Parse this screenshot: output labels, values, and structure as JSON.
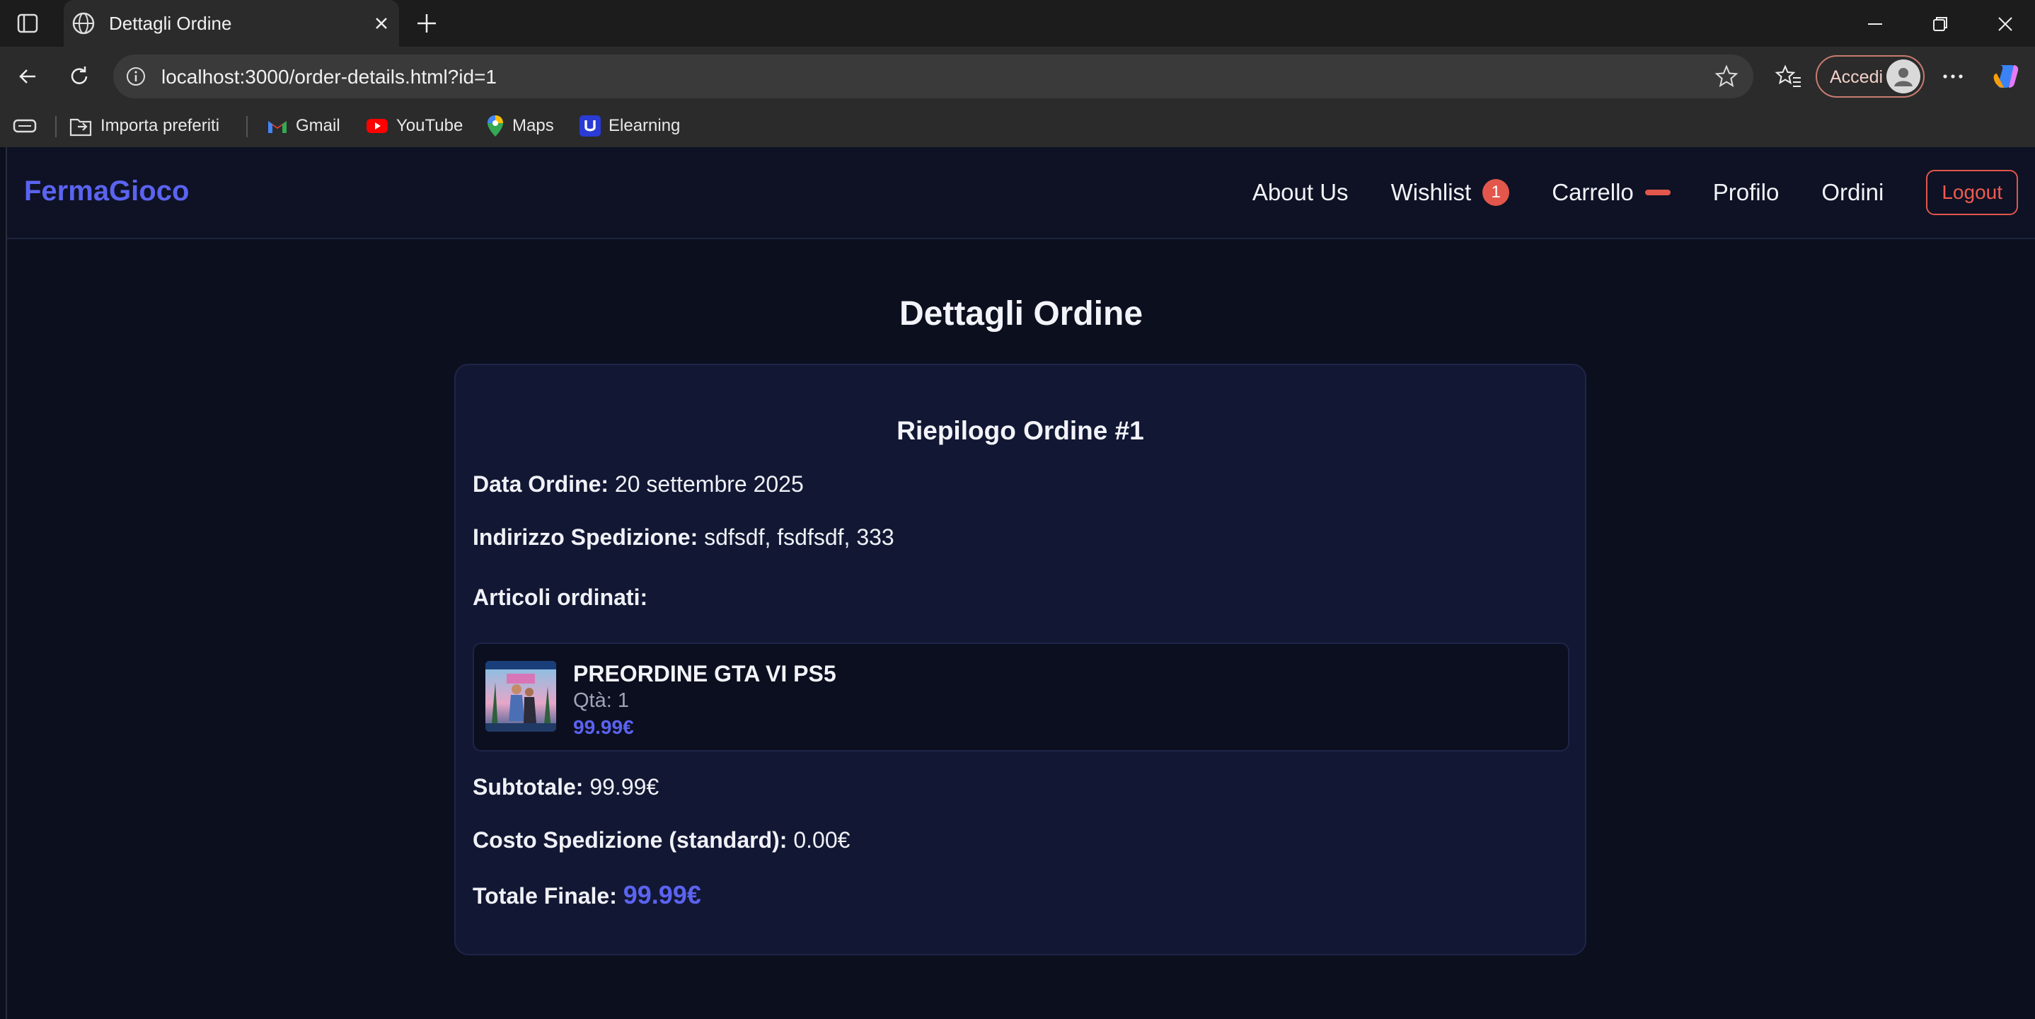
{
  "browser": {
    "tab_title": "Dettagli Ordine",
    "url": "localhost:3000/order-details.html?id=1",
    "signin_label": "Accedi",
    "bookmarks": [
      {
        "label": "Importa preferiti",
        "icon": "import-icon"
      },
      {
        "label": "Gmail",
        "icon": "gmail-icon"
      },
      {
        "label": "YouTube",
        "icon": "youtube-icon"
      },
      {
        "label": "Maps",
        "icon": "maps-icon"
      },
      {
        "label": "Elearning",
        "icon": "elearning-icon"
      }
    ]
  },
  "navbar": {
    "brand": "FermaGioco",
    "links": {
      "about": "About Us",
      "wishlist": "Wishlist",
      "wishlist_count": "1",
      "cart": "Carrello",
      "profile": "Profilo",
      "orders": "Ordini"
    },
    "logout": "Logout"
  },
  "page": {
    "title": "Dettagli Ordine"
  },
  "order": {
    "summary_title": "Riepilogo Ordine #1",
    "date_label": "Data Ordine:",
    "date_value": "20 settembre 2025",
    "address_label": "Indirizzo Spedizione:",
    "address_value": "sdfsdf, fsdfsdf, 333",
    "items_label": "Articoli ordinati:",
    "items": [
      {
        "name": "PREORDINE GTA VI PS5",
        "qty": "Qtà: 1",
        "price": "99.99€"
      }
    ],
    "subtotal_label": "Subtotale:",
    "subtotal_value": "99.99€",
    "shipping_label": "Costo Spedizione (standard):",
    "shipping_value": "0.00€",
    "total_label": "Totale Finale:",
    "total_value": "99.99€"
  },
  "colors": {
    "accent": "#5b63f0",
    "danger": "#e2564b",
    "background": "#0c0f1e",
    "card": "#121733"
  }
}
